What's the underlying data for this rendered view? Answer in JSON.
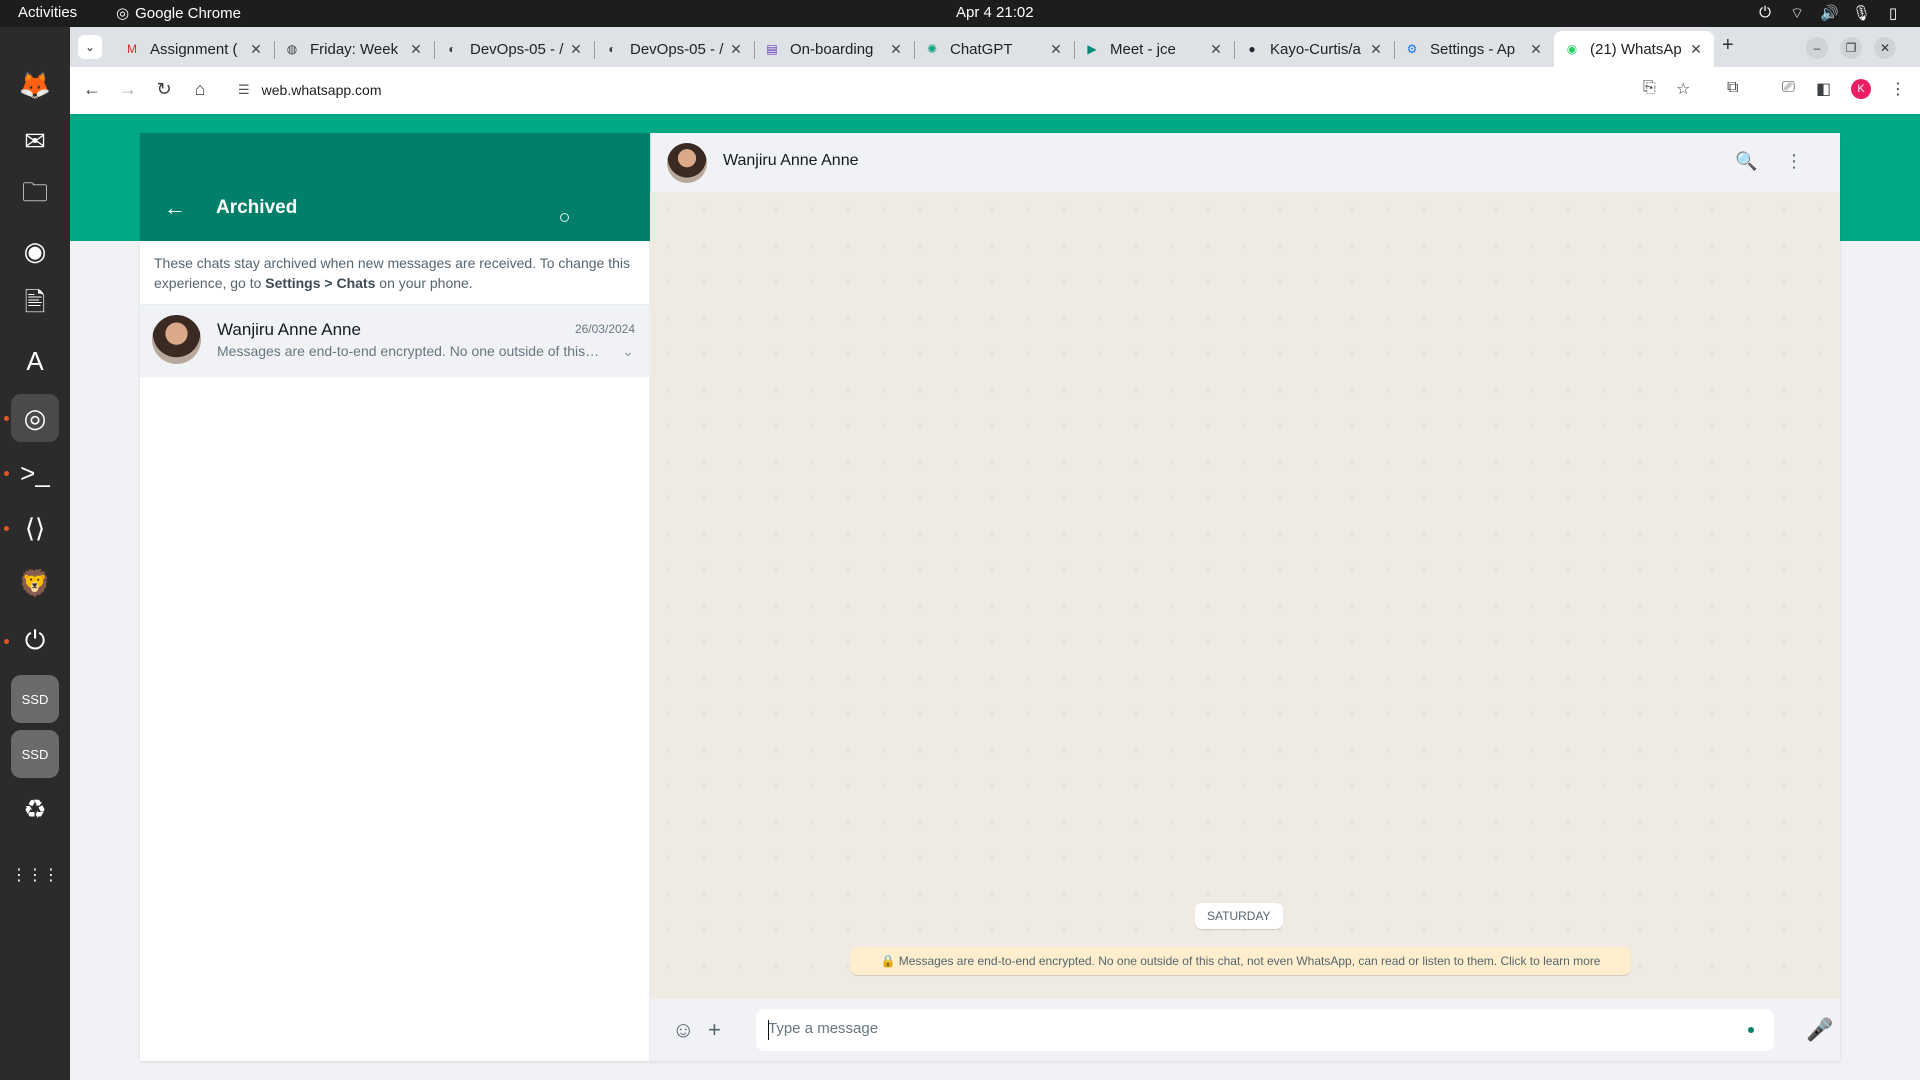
{
  "system_bar": {
    "activities": "Activities",
    "app_name": "Google Chrome",
    "clock": "Apr 4  21:02"
  },
  "dock": {
    "items": [
      {
        "name": "firefox-icon",
        "glyph": "🦊"
      },
      {
        "name": "thunderbird-icon",
        "glyph": "✉"
      },
      {
        "name": "files-icon",
        "glyph": "🗀"
      },
      {
        "name": "rhythmbox-icon",
        "glyph": "◉"
      },
      {
        "name": "libreoffice-writer-icon",
        "glyph": "🖹"
      },
      {
        "name": "app-center-icon",
        "glyph": "A"
      },
      {
        "name": "chrome-icon",
        "glyph": "◎"
      },
      {
        "name": "terminal-icon",
        "glyph": ">_"
      },
      {
        "name": "vscode-icon",
        "glyph": "⟨⟩"
      },
      {
        "name": "brave-icon",
        "glyph": "🦁"
      },
      {
        "name": "timer-icon",
        "glyph": "⏻"
      },
      {
        "name": "ssd-drive-icon",
        "glyph": "SSD"
      },
      {
        "name": "ssd-drive-icon",
        "glyph": "SSD"
      },
      {
        "name": "trash-icon",
        "glyph": "♻"
      },
      {
        "name": "show-apps-icon",
        "glyph": "⋮⋮⋮"
      }
    ]
  },
  "browser": {
    "tabs": [
      {
        "title": "Assignment (",
        "icon": "gmail-icon",
        "glyph": "M",
        "color": "#d93025"
      },
      {
        "title": "Friday: Week",
        "icon": "globe-icon",
        "glyph": "◍",
        "color": "#3c4043"
      },
      {
        "title": "DevOps-05 - /",
        "icon": "devops-icon",
        "glyph": "◐",
        "color": "#3c4043"
      },
      {
        "title": "DevOps-05 - /",
        "icon": "devops-icon",
        "glyph": "◐",
        "color": "#3c4043"
      },
      {
        "title": "On-boarding",
        "icon": "forms-icon",
        "glyph": "▤",
        "color": "#673ab7"
      },
      {
        "title": "ChatGPT",
        "icon": "chatgpt-icon",
        "glyph": "✺",
        "color": "#10a37f"
      },
      {
        "title": "Meet - jce",
        "icon": "meet-icon",
        "glyph": "▶",
        "color": "#00897b"
      },
      {
        "title": "Kayo-Curtis/a",
        "icon": "github-icon",
        "glyph": "●",
        "color": "#24292f"
      },
      {
        "title": "Settings - Ap",
        "icon": "gear-icon",
        "glyph": "⚙",
        "color": "#1a73e8"
      },
      {
        "title": "(21) WhatsAp",
        "icon": "whatsapp-icon",
        "glyph": "◉",
        "color": "#25d366"
      }
    ],
    "url": "web.whatsapp.com",
    "profile_initial": "K"
  },
  "whatsapp": {
    "left_title": "Archived",
    "archive_note_1": "These chats stay archived when new messages are received. To change this experience, go to ",
    "archive_note_settings": "Settings > Chats",
    "archive_note_2": " on your phone.",
    "chat": {
      "name": "Wanjiru Anne Anne",
      "date": "26/03/2024",
      "preview": "Messages are end-to-end encrypted. No one outside of this chat, not even WhatsApp, can read or listen to them."
    },
    "conversation": {
      "name": "Wanjiru Anne Anne",
      "day_chip": "SATURDAY",
      "e2e_notice": "🔒 Messages are end-to-end encrypted. No one outside of this chat, not even WhatsApp, can read or listen to them. Click to learn more",
      "input_placeholder": "Type a message"
    },
    "colors": {
      "header_green": "#008069",
      "band_green": "#00a884",
      "chat_bg": "#efeae2"
    }
  }
}
